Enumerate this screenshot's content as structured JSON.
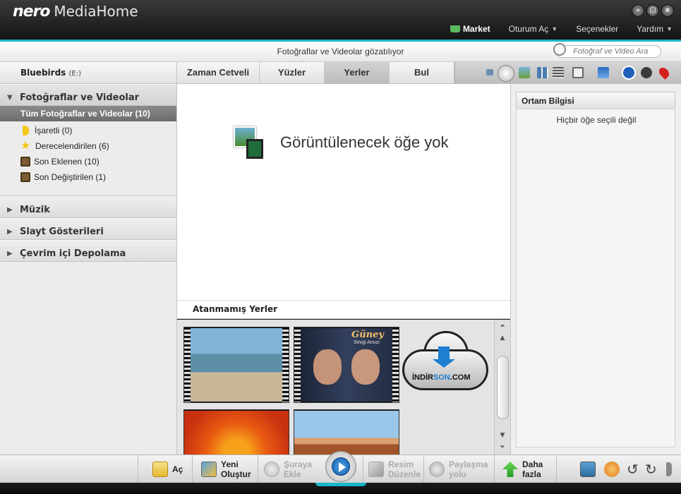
{
  "app": {
    "brand": "nero",
    "product": "MediaHome"
  },
  "window": {
    "minimize": "–",
    "restore": "▢",
    "close": "×"
  },
  "topmenu": {
    "market": "Market",
    "login": "Oturum Aç",
    "options": "Seçenekler",
    "help": "Yardım"
  },
  "search": {
    "status": "Fotoğraflar ve Videolar gözatılıyor",
    "placeholder": "Fotoğraf ve Video Ara"
  },
  "sidebar": {
    "drive": "Bluebirds",
    "drive_sub": "(E:)",
    "photos_section": "Fotoğraflar ve Videolar",
    "all_item": "Tüm Fotoğraflar ve Videolar (10)",
    "items": [
      {
        "label": "İşaretli (0)",
        "icon": "flag-icon"
      },
      {
        "label": "Derecelendirilen (6)",
        "icon": "star-icon"
      },
      {
        "label": "Son Eklenen (10)",
        "icon": "frame-icon"
      },
      {
        "label": "Son Değiştirilen (1)",
        "icon": "frame-icon"
      }
    ],
    "music": "Müzik",
    "slideshows": "Slayt Gösterileri",
    "online": "Çevrim içi Depolama"
  },
  "tabs": [
    {
      "label": "Zaman Cetveli"
    },
    {
      "label": "Yüzler"
    },
    {
      "label": "Yerler",
      "active": true
    },
    {
      "label": "Bul"
    }
  ],
  "main": {
    "empty_message": "Görüntülenecek öğe yok",
    "unassigned_title": "Atanmamış Yerler",
    "album_title": "Güney",
    "album_subtitle": "Sevgi Arsızı",
    "watermark_pre": "İNDİR",
    "watermark_son": "SON",
    "watermark_post": ".COM"
  },
  "rightpanel": {
    "tab": "Ortam Bilgisi",
    "no_selection": "Hiçbir öğe seçili değil"
  },
  "bottombar": {
    "open": "Aç",
    "new_line1": "Yeni",
    "new_line2": "Oluştur",
    "add_line1": "Şuraya",
    "add_line2": "Ekle",
    "edit_line1": "Resim",
    "edit_line2": "Düzenle",
    "share_line1": "Paylaşma",
    "share_line2": "yolu",
    "more_line1": "Daha",
    "more_line2": "fazla"
  },
  "colors": {
    "accent": "#19b6c9",
    "selected": "#7a7a7a",
    "play": "#1e6fc4"
  }
}
